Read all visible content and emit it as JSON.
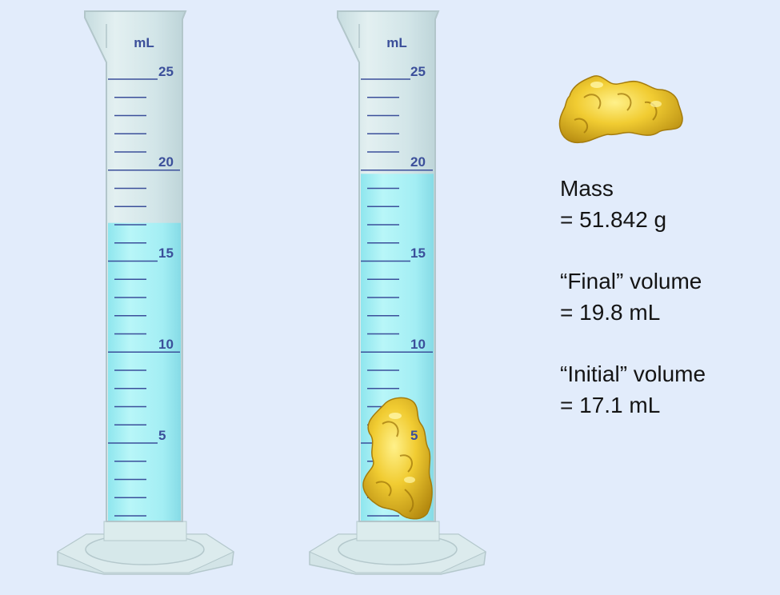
{
  "cylinders": [
    {
      "id": "initial",
      "unit": "mL",
      "major_labels": [
        "25",
        "20",
        "15",
        "10",
        "5"
      ],
      "liquid_level_ml": 17.1,
      "contains_nugget": false
    },
    {
      "id": "final",
      "unit": "mL",
      "major_labels": [
        "25",
        "20",
        "15",
        "10",
        "5"
      ],
      "liquid_level_ml": 19.8,
      "contains_nugget": true
    }
  ],
  "info": {
    "mass_label": "Mass",
    "mass_value": "= 51.842 g",
    "final_label": "“Final” volume",
    "final_value": "= 19.8 mL",
    "initial_label": "“Initial” volume",
    "initial_value": "= 17.1 mL"
  },
  "colors": {
    "background": "#e2ecfb",
    "glass": "#cfe3e6",
    "liquid": "#9ff0f6",
    "tick": "#3b4f9a",
    "gold": "#e8c12a"
  }
}
